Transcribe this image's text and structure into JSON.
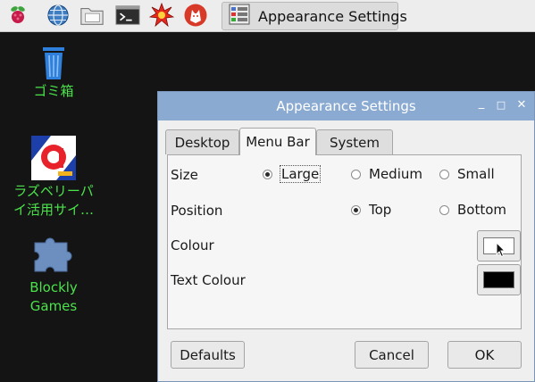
{
  "taskbar": {
    "launchers": [
      {
        "name": "raspberry-menu-icon"
      },
      {
        "name": "web-browser-icon"
      },
      {
        "name": "file-manager-icon"
      },
      {
        "name": "terminal-icon"
      },
      {
        "name": "burst-app-icon"
      },
      {
        "name": "wolfram-icon"
      }
    ],
    "task_label": "Appearance Settings"
  },
  "desktop": {
    "icons": [
      {
        "label_lines": [
          "ゴミ箱"
        ]
      },
      {
        "label_lines": [
          "ラズベリーパ",
          "イ活用サイ…"
        ]
      },
      {
        "label_lines": [
          "Blockly",
          "Games"
        ]
      }
    ]
  },
  "window": {
    "title": "Appearance Settings",
    "controls": {
      "minimize": "_",
      "maximize": "□",
      "close": "✕"
    },
    "tabs": [
      "Desktop",
      "Menu Bar",
      "System"
    ],
    "active_tab": "Menu Bar",
    "size": {
      "label": "Size",
      "options": [
        "Large",
        "Medium",
        "Small"
      ],
      "selected": "Large"
    },
    "position": {
      "label": "Position",
      "options": [
        "Top",
        "Bottom"
      ],
      "selected": "Top"
    },
    "colour": {
      "label": "Colour",
      "value": "#ffffff"
    },
    "text_colour": {
      "label": "Text Colour",
      "value": "#000000"
    },
    "buttons": {
      "defaults": "Defaults",
      "cancel": "Cancel",
      "ok": "OK"
    }
  },
  "colors": {
    "titlebar": "#8aaad2",
    "desktop_bg": "#141414",
    "icon_label": "#4be24b"
  }
}
